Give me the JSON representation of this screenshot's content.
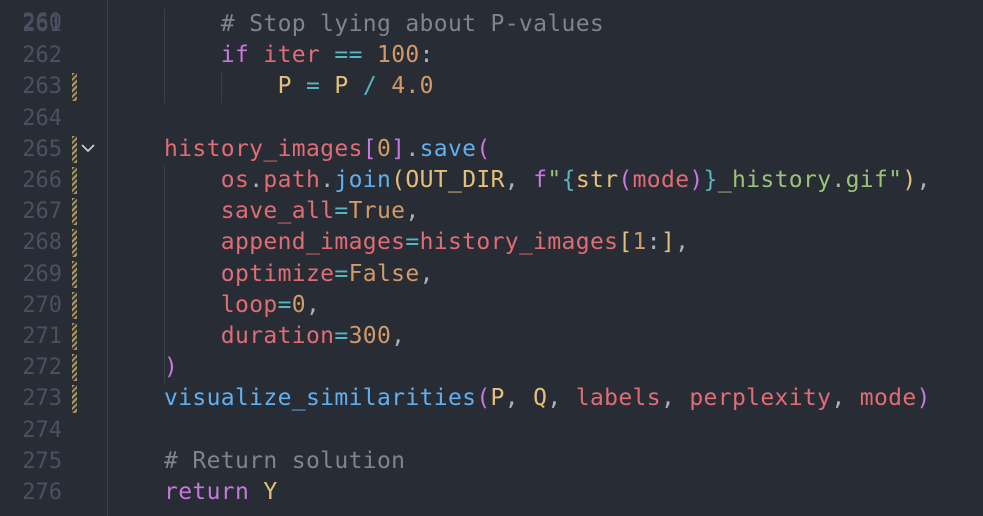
{
  "editor": {
    "top_peek_line": "260",
    "lines": [
      {
        "num": "261",
        "tokens": [
          {
            "t": "# Stop lying about P-values",
            "c": "t-comment"
          }
        ],
        "indent": 1
      },
      {
        "num": "262",
        "tokens": [
          {
            "t": "if",
            "c": "t-kw"
          },
          {
            "t": " ",
            "c": "t-punc"
          },
          {
            "t": "iter",
            "c": "t-var"
          },
          {
            "t": " ",
            "c": "t-punc"
          },
          {
            "t": "==",
            "c": "t-op"
          },
          {
            "t": " ",
            "c": "t-punc"
          },
          {
            "t": "100",
            "c": "t-num"
          },
          {
            "t": ":",
            "c": "t-punc"
          }
        ],
        "indent": 1
      },
      {
        "num": "263",
        "tokens": [
          {
            "t": "P",
            "c": "t-yel"
          },
          {
            "t": " ",
            "c": "t-punc"
          },
          {
            "t": "=",
            "c": "t-op"
          },
          {
            "t": " ",
            "c": "t-punc"
          },
          {
            "t": "P",
            "c": "t-yel"
          },
          {
            "t": " ",
            "c": "t-punc"
          },
          {
            "t": "/",
            "c": "t-op"
          },
          {
            "t": " ",
            "c": "t-punc"
          },
          {
            "t": "4.0",
            "c": "t-num"
          }
        ],
        "indent": 2,
        "modified": true
      },
      {
        "num": "264",
        "tokens": [],
        "indent": 0
      },
      {
        "num": "265",
        "tokens": [
          {
            "t": "history_images",
            "c": "t-var"
          },
          {
            "t": "[",
            "c": "t-br1"
          },
          {
            "t": "0",
            "c": "t-num"
          },
          {
            "t": "]",
            "c": "t-br1"
          },
          {
            "t": ".",
            "c": "t-punc"
          },
          {
            "t": "save",
            "c": "t-fn"
          },
          {
            "t": "(",
            "c": "t-br1"
          }
        ],
        "indent": 0,
        "modified": true,
        "fold": true
      },
      {
        "num": "266",
        "tokens": [
          {
            "t": "os",
            "c": "t-var"
          },
          {
            "t": ".",
            "c": "t-punc"
          },
          {
            "t": "path",
            "c": "t-var"
          },
          {
            "t": ".",
            "c": "t-punc"
          },
          {
            "t": "join",
            "c": "t-fn"
          },
          {
            "t": "(",
            "c": "t-br2"
          },
          {
            "t": "OUT_DIR",
            "c": "t-yel"
          },
          {
            "t": ", ",
            "c": "t-punc"
          },
          {
            "t": "f",
            "c": "t-kw"
          },
          {
            "t": "\"",
            "c": "t-str"
          },
          {
            "t": "{",
            "c": "t-br3"
          },
          {
            "t": "str",
            "c": "t-yel"
          },
          {
            "t": "(",
            "c": "t-br1"
          },
          {
            "t": "mode",
            "c": "t-var"
          },
          {
            "t": ")",
            "c": "t-br1"
          },
          {
            "t": "}",
            "c": "t-br3"
          },
          {
            "t": "_history.gif\"",
            "c": "t-str"
          },
          {
            "t": ")",
            "c": "t-br2"
          },
          {
            "t": ",",
            "c": "t-punc"
          }
        ],
        "indent": 1,
        "modified": true
      },
      {
        "num": "267",
        "tokens": [
          {
            "t": "save_all",
            "c": "t-var"
          },
          {
            "t": "=",
            "c": "t-op"
          },
          {
            "t": "True",
            "c": "t-num"
          },
          {
            "t": ",",
            "c": "t-punc"
          }
        ],
        "indent": 1,
        "modified": true
      },
      {
        "num": "268",
        "tokens": [
          {
            "t": "append_images",
            "c": "t-var"
          },
          {
            "t": "=",
            "c": "t-op"
          },
          {
            "t": "history_images",
            "c": "t-var"
          },
          {
            "t": "[",
            "c": "t-br2"
          },
          {
            "t": "1",
            "c": "t-num"
          },
          {
            "t": ":",
            "c": "t-punc"
          },
          {
            "t": "]",
            "c": "t-br2"
          },
          {
            "t": ",",
            "c": "t-punc"
          }
        ],
        "indent": 1,
        "modified": true
      },
      {
        "num": "269",
        "tokens": [
          {
            "t": "optimize",
            "c": "t-var"
          },
          {
            "t": "=",
            "c": "t-op"
          },
          {
            "t": "False",
            "c": "t-num"
          },
          {
            "t": ",",
            "c": "t-punc"
          }
        ],
        "indent": 1,
        "modified": true
      },
      {
        "num": "270",
        "tokens": [
          {
            "t": "loop",
            "c": "t-var"
          },
          {
            "t": "=",
            "c": "t-op"
          },
          {
            "t": "0",
            "c": "t-num"
          },
          {
            "t": ",",
            "c": "t-punc"
          }
        ],
        "indent": 1,
        "modified": true
      },
      {
        "num": "271",
        "tokens": [
          {
            "t": "duration",
            "c": "t-var"
          },
          {
            "t": "=",
            "c": "t-op"
          },
          {
            "t": "300",
            "c": "t-num"
          },
          {
            "t": ",",
            "c": "t-punc"
          }
        ],
        "indent": 1,
        "modified": true
      },
      {
        "num": "272",
        "tokens": [
          {
            "t": ")",
            "c": "t-br1"
          }
        ],
        "indent": 0,
        "modified": true
      },
      {
        "num": "273",
        "tokens": [
          {
            "t": "visualize_similarities",
            "c": "t-fn"
          },
          {
            "t": "(",
            "c": "t-br1"
          },
          {
            "t": "P",
            "c": "t-yel"
          },
          {
            "t": ", ",
            "c": "t-punc"
          },
          {
            "t": "Q",
            "c": "t-yel"
          },
          {
            "t": ", ",
            "c": "t-punc"
          },
          {
            "t": "labels",
            "c": "t-var"
          },
          {
            "t": ", ",
            "c": "t-punc"
          },
          {
            "t": "perplexity",
            "c": "t-var"
          },
          {
            "t": ", ",
            "c": "t-punc"
          },
          {
            "t": "mode",
            "c": "t-var"
          },
          {
            "t": ")",
            "c": "t-br1"
          }
        ],
        "indent": 0,
        "modified": true
      },
      {
        "num": "274",
        "tokens": [],
        "indent": 0
      },
      {
        "num": "275",
        "tokens": [
          {
            "t": "# Return solution",
            "c": "t-comment"
          }
        ],
        "indent": 0
      },
      {
        "num": "276",
        "tokens": [
          {
            "t": "return",
            "c": "t-kw"
          },
          {
            "t": " ",
            "c": "t-punc"
          },
          {
            "t": "Y",
            "c": "t-yel"
          }
        ],
        "indent": 0
      }
    ]
  },
  "icons": {
    "fold": "chevron-down-icon"
  },
  "colors": {
    "background": "#282c34",
    "line_number": "#495162",
    "comment": "#7f848e",
    "keyword": "#c678dd",
    "variable": "#e06c75",
    "number": "#d19a66",
    "operator": "#56b6c2",
    "function": "#61afef",
    "string": "#98c379",
    "constant": "#e5c07b"
  }
}
